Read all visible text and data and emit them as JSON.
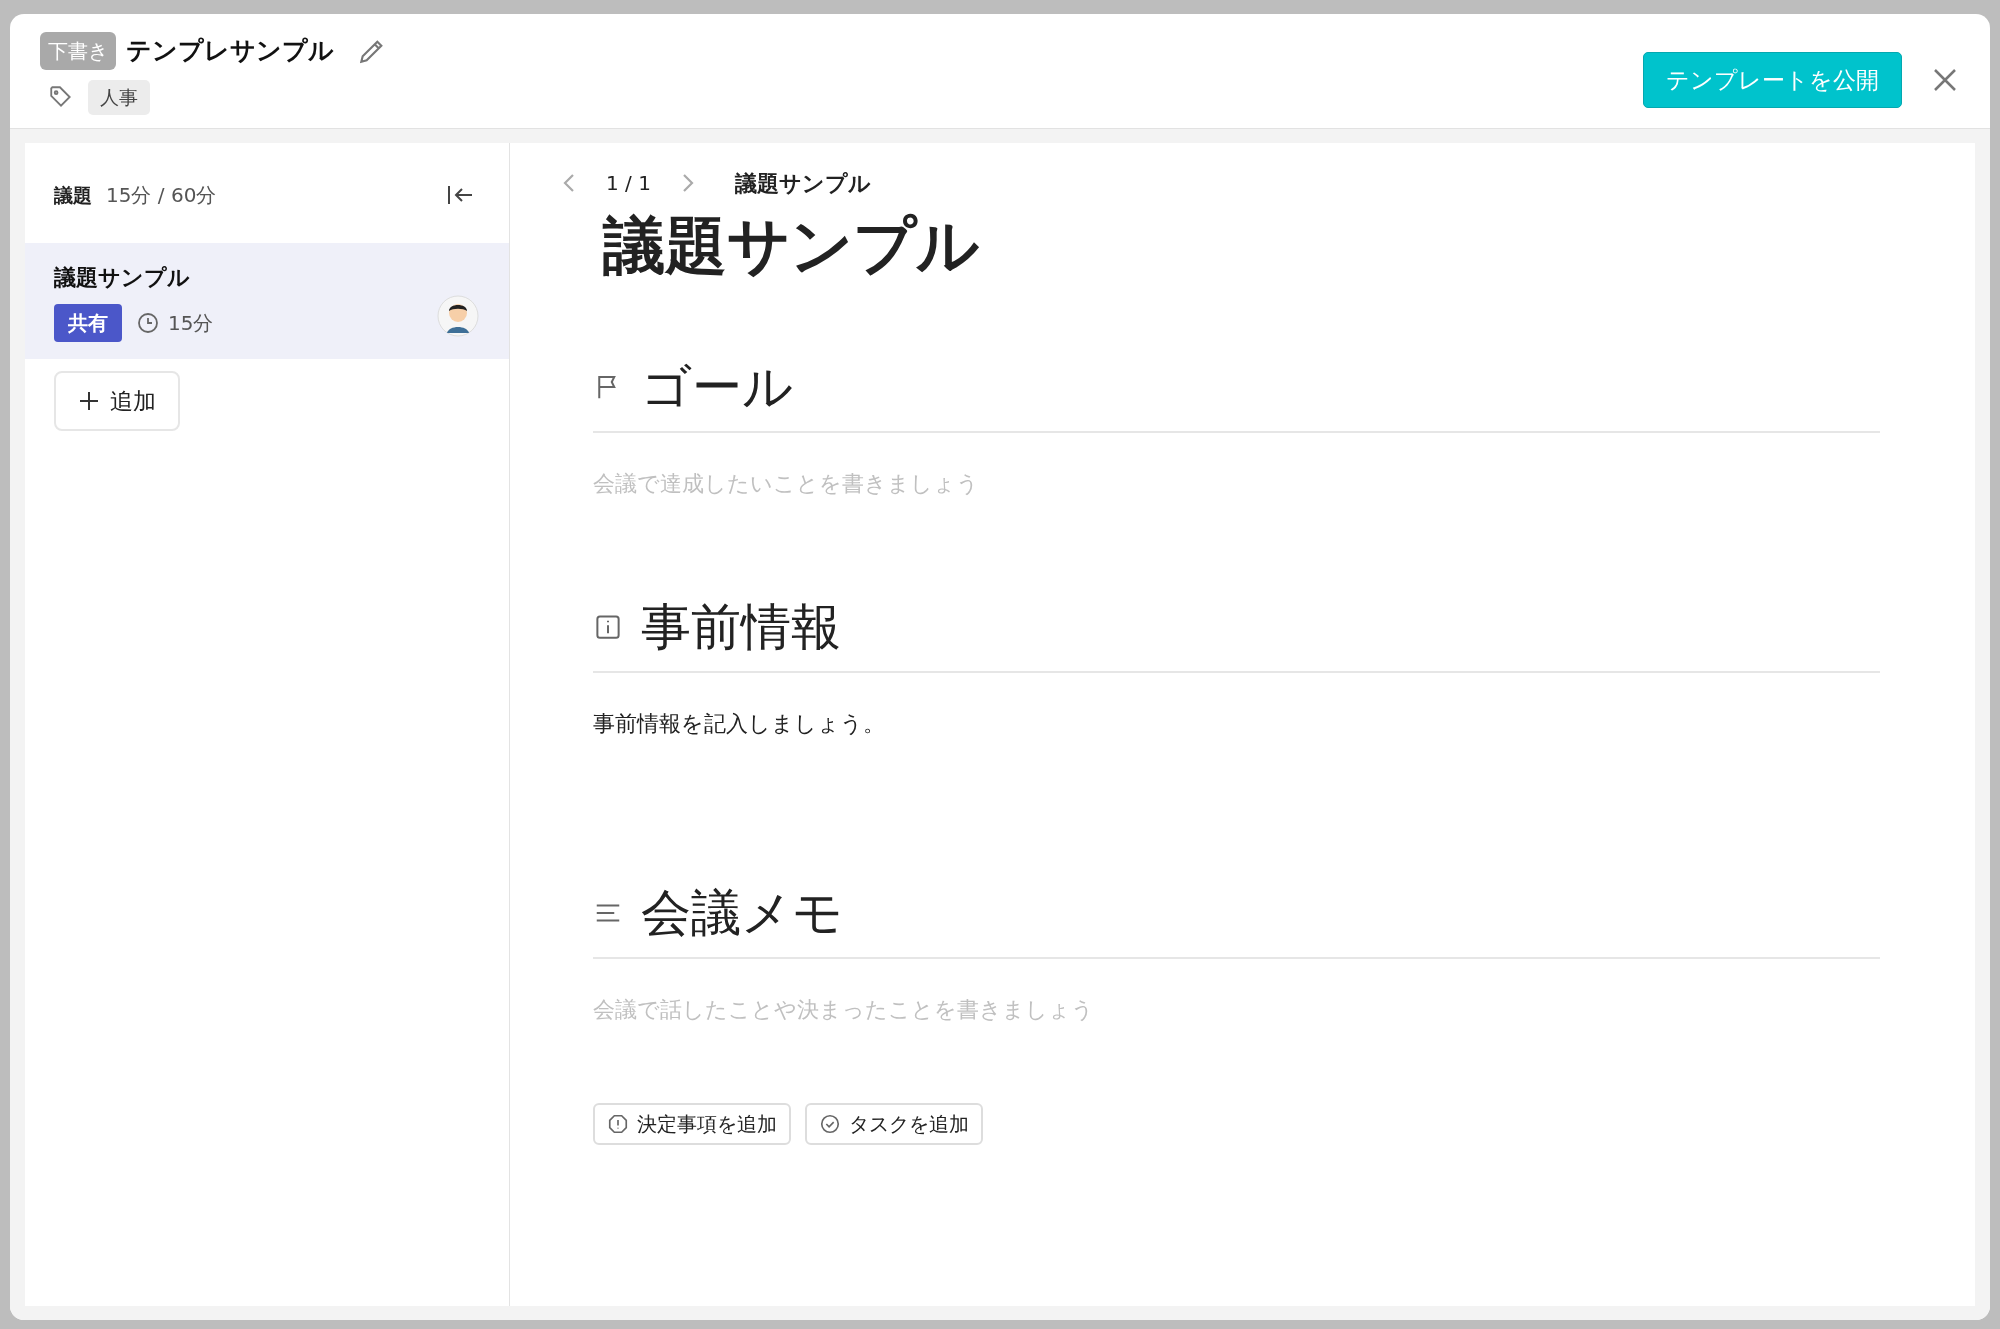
{
  "header": {
    "status_badge": "下書き",
    "title": "テンプレサンプル",
    "tags": [
      "人事"
    ],
    "publish_button": "テンプレートを公開"
  },
  "agenda_panel": {
    "label": "議題",
    "time_summary": "15分 / 60分",
    "items": [
      {
        "title": "議題サンプル",
        "badge": "共有",
        "duration": "15分",
        "selected": true
      }
    ],
    "add_button": "追加"
  },
  "content": {
    "pager": "1 / 1",
    "breadcrumb": "議題サンプル",
    "title": "議題サンプル",
    "sections": [
      {
        "kind": "goal",
        "heading": "ゴール",
        "placeholder": "会議で達成したいことを書きましょう"
      },
      {
        "kind": "info",
        "heading": "事前情報",
        "text": "事前情報を記入しましょう。"
      },
      {
        "kind": "notes",
        "heading": "会議メモ",
        "placeholder": "会議で話したことや決まったことを書きましょう"
      }
    ],
    "actions": [
      {
        "kind": "decision",
        "label": "決定事項を追加"
      },
      {
        "kind": "task",
        "label": "タスクを追加"
      }
    ]
  }
}
